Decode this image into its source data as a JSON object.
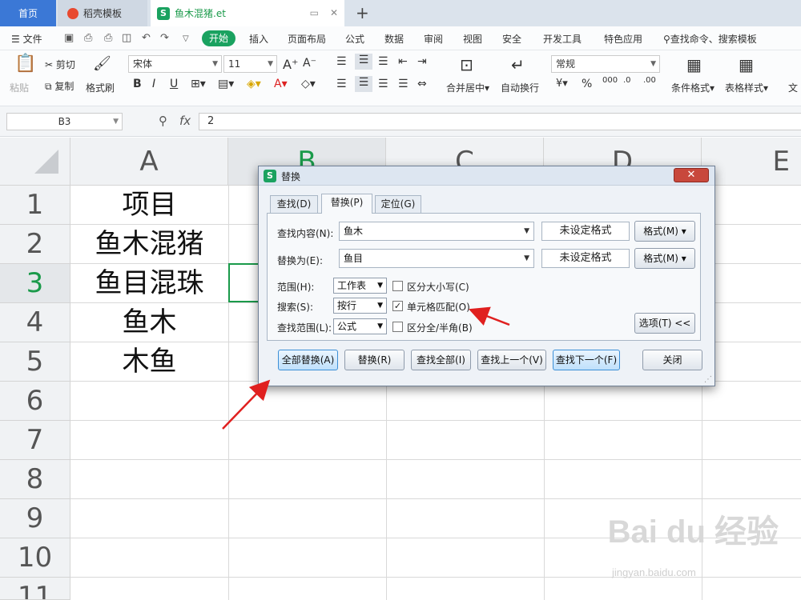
{
  "tabs": {
    "home": "首页",
    "daoke": "稻壳模板",
    "file": "鱼木混猪.et"
  },
  "menu": {
    "file": "文件",
    "items": [
      "开始",
      "插入",
      "页面布局",
      "公式",
      "数据",
      "审阅",
      "视图",
      "安全",
      "开发工具",
      "特色应用"
    ],
    "search": "查找命令、搜索模板"
  },
  "ribbon": {
    "paste": "粘贴",
    "cut": "剪切",
    "copy": "复制",
    "format_painter": "格式刷",
    "font_name": "宋体",
    "font_size": "11",
    "merge": "合并居中",
    "wrap": "自动换行",
    "number_format": "常规",
    "cond_format": "条件格式",
    "table_style": "表格样式",
    "doc": "文"
  },
  "formula_bar": {
    "cell_ref": "B3",
    "fx": "fx",
    "value": "2"
  },
  "sheet": {
    "columns": [
      "A",
      "B",
      "C",
      "D",
      "E"
    ],
    "rows": [
      "1",
      "2",
      "3",
      "4",
      "5",
      "6",
      "7",
      "8",
      "9",
      "10",
      "11"
    ],
    "cells": [
      "项目",
      "鱼木混猪",
      "鱼目混珠",
      "鱼木",
      "木鱼"
    ]
  },
  "dialog": {
    "title": "替换",
    "tabs": [
      "查找(D)",
      "替换(P)",
      "定位(G)"
    ],
    "find_label": "查找内容(N):",
    "find_value": "鱼木",
    "replace_label": "替换为(E):",
    "replace_value": "鱼目",
    "no_format": "未设定格式",
    "format_btn": "格式(M)",
    "scope_label": "范围(H):",
    "scope_value": "工作表",
    "search_label": "搜索(S):",
    "search_value": "按行",
    "lookin_label": "查找范围(L):",
    "lookin_value": "公式",
    "match_case": "区分大小写(C)",
    "match_cell": "单元格匹配(O)",
    "match_width": "区分全/半角(B)",
    "options_btn": "选项(T) <<",
    "buttons": [
      "全部替换(A)",
      "替换(R)",
      "查找全部(I)",
      "查找上一个(V)",
      "查找下一个(F)",
      "关闭"
    ]
  },
  "watermark": {
    "logo": "Bai du 经验",
    "url": "jingyan.baidu.com"
  }
}
